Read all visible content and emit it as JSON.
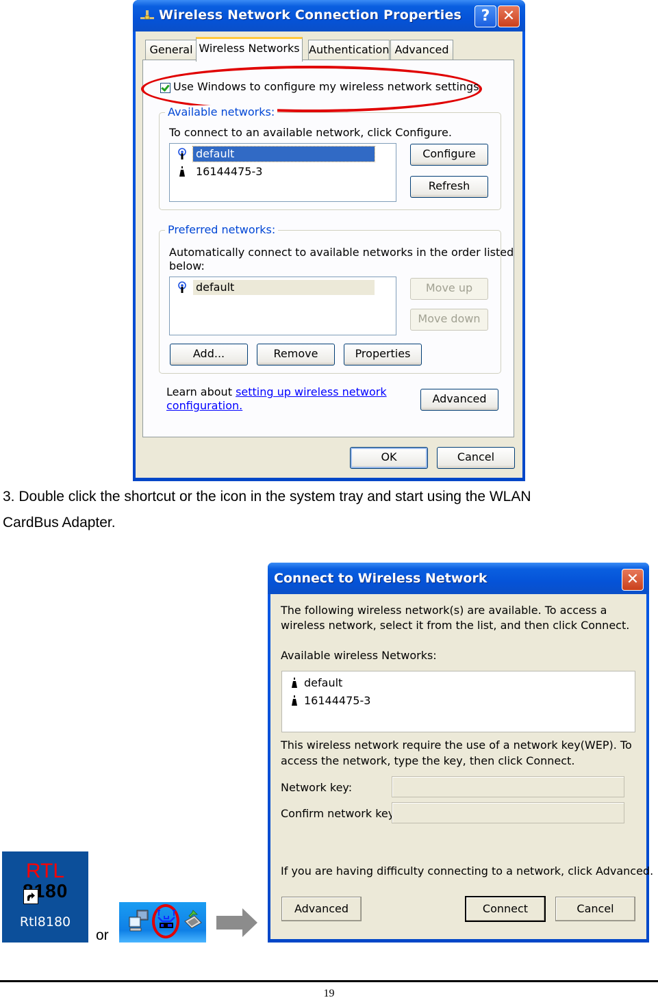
{
  "properties_dialog": {
    "title": "Wireless Network Connection Properties",
    "help_label": "?",
    "close_label": "✕",
    "tabs": [
      {
        "label": "General",
        "active": false
      },
      {
        "label": "Wireless Networks",
        "active": true
      },
      {
        "label": "Authentication",
        "active": false
      },
      {
        "label": "Advanced",
        "active": false
      }
    ],
    "use_windows_checkbox": {
      "label": "Use Windows to configure my wireless network settings",
      "checked": true
    },
    "available": {
      "legend": "Available networks:",
      "description": "To connect to an available network, click Configure.",
      "networks": [
        {
          "name": "default",
          "icon": "preferred-antenna-icon",
          "selected": true
        },
        {
          "name": "16144475-3",
          "icon": "antenna-icon",
          "selected": false
        }
      ],
      "configure_label": "Configure",
      "refresh_label": "Refresh"
    },
    "preferred": {
      "legend": "Preferred networks:",
      "description_line1": "Automatically connect to available networks in the order listed",
      "description_line2": "below:",
      "networks": [
        {
          "name": "default",
          "icon": "preferred-antenna-icon"
        }
      ],
      "move_up_label": "Move up",
      "move_down_label": "Move down",
      "add_label": "Add...",
      "remove_label": "Remove",
      "properties_label": "Properties"
    },
    "learn_prefix": "Learn about ",
    "learn_link_line1": "setting up wireless network",
    "learn_link_line2": "configuration.",
    "advanced_label": "Advanced",
    "ok_label": "OK",
    "cancel_label": "Cancel"
  },
  "instruction": {
    "line1": "3. Double click the shortcut or the icon in the system tray and start using the WLAN",
    "line2": "CardBus Adapter."
  },
  "shortcut": {
    "brand": "RTL",
    "model": "8180",
    "caption": "Rtl8180"
  },
  "or_label": "or",
  "connect_dialog": {
    "title": "Connect to Wireless Network",
    "close_label": "✕",
    "intro_line1": "The following wireless network(s) are available. To access a",
    "intro_line2": "wireless network, select it from the list, and then click Connect.",
    "list_label": "Available wireless Networks:",
    "networks": [
      {
        "name": "default",
        "icon": "antenna-icon"
      },
      {
        "name": "16144475-3",
        "icon": "antenna-icon"
      }
    ],
    "wep_line1": "This wireless network require the use of a network key(WEP). To",
    "wep_line2": "access the network, type the key, then click Connect.",
    "network_key_label": "Network key:",
    "network_key_value": "",
    "confirm_key_label": "Confirm network key:",
    "confirm_key_value": "",
    "help_text": "If you are having difficulty connecting to a network, click Advanced.",
    "advanced_label": "Advanced",
    "connect_label": "Connect",
    "cancel_label": "Cancel"
  },
  "page_number": "19",
  "colors": {
    "xp_title_blue": "#0553d8",
    "dialog_face": "#ece9d8",
    "selection_blue": "#316ac5",
    "group_legend_blue": "#0046d5",
    "highlight_red": "#e00000"
  }
}
